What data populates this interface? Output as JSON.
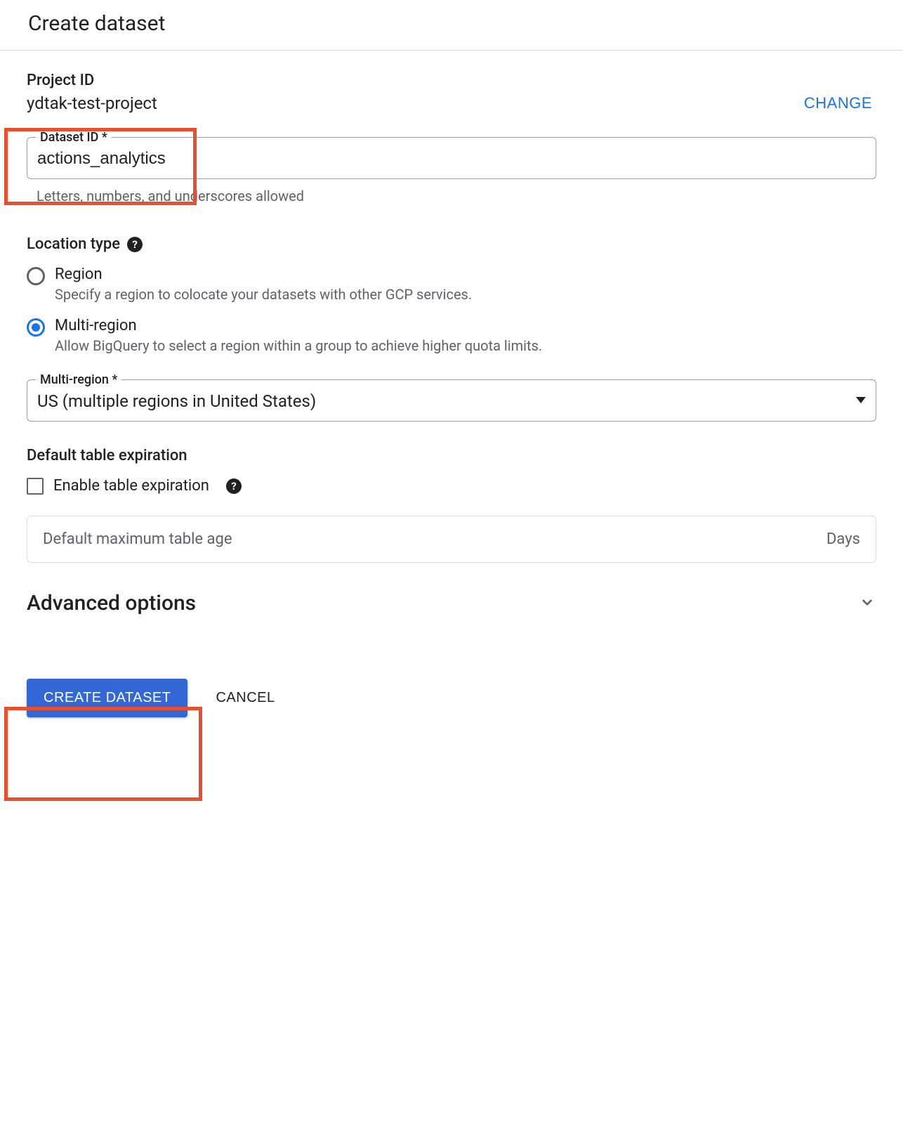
{
  "header": {
    "title": "Create dataset"
  },
  "project": {
    "label": "Project ID",
    "value": "ydtak-test-project",
    "change": "CHANGE"
  },
  "dataset_field": {
    "label": "Dataset ID *",
    "value": "actions_analytics",
    "helper": "Letters, numbers, and underscores allowed"
  },
  "location": {
    "title": "Location type",
    "options": [
      {
        "label": "Region",
        "desc": "Specify a region to colocate your datasets with other GCP services.",
        "selected": false
      },
      {
        "label": "Multi-region",
        "desc": "Allow BigQuery to select a region within a group to achieve higher quota limits.",
        "selected": true
      }
    ]
  },
  "multiregion_select": {
    "label": "Multi-region *",
    "value": "US (multiple regions in United States)"
  },
  "expiration": {
    "title": "Default table expiration",
    "checkbox_label": "Enable table expiration",
    "disabled_placeholder": "Default maximum table age",
    "disabled_suffix": "Days"
  },
  "advanced": {
    "title": "Advanced options"
  },
  "footer": {
    "primary": "CREATE DATASET",
    "cancel": "CANCEL"
  }
}
